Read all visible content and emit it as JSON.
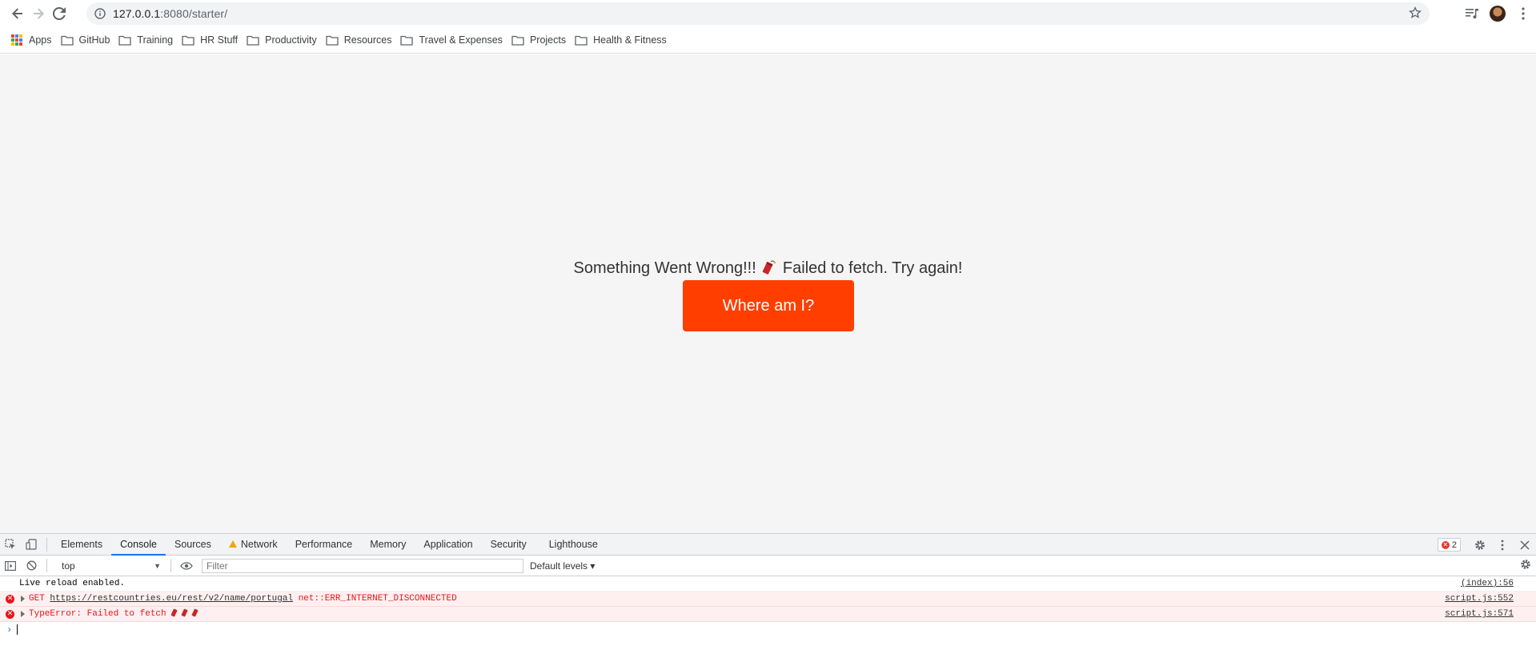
{
  "browser": {
    "url_host": "127.0.0.1",
    "url_rest": ":8080/starter/"
  },
  "bookmarks": [
    {
      "label": "Apps",
      "icon": "apps-grid-icon"
    },
    {
      "label": "GitHub",
      "icon": "folder-icon"
    },
    {
      "label": "Training",
      "icon": "folder-icon"
    },
    {
      "label": "HR Stuff",
      "icon": "folder-icon"
    },
    {
      "label": "Productivity",
      "icon": "folder-icon"
    },
    {
      "label": "Resources",
      "icon": "folder-icon"
    },
    {
      "label": "Travel & Expenses",
      "icon": "folder-icon"
    },
    {
      "label": "Projects",
      "icon": "folder-icon"
    },
    {
      "label": "Health & Fitness",
      "icon": "folder-icon"
    }
  ],
  "page": {
    "error_part1": "Something Went Wrong!!!",
    "error_part2": "Failed to fetch. Try again!",
    "button_label": "Where am I?",
    "button_color": "#ff3e00",
    "background": "#f5f5f5"
  },
  "devtools": {
    "tabs": [
      "Elements",
      "Console",
      "Sources",
      "Network",
      "Performance",
      "Memory",
      "Application",
      "Security",
      "Lighthouse"
    ],
    "active_tab": "Console",
    "warning_tab": "Network",
    "error_count": "2",
    "context": "top",
    "filter_placeholder": "Filter",
    "levels": "Default levels ▾",
    "logs": [
      {
        "type": "info",
        "text": "Live reload enabled.",
        "source": "(index):56"
      },
      {
        "type": "error",
        "method": "GET",
        "url": "https://restcountries.eu/rest/v2/name/portugal",
        "error": "net::ERR_INTERNET_DISCONNECTED",
        "source": "script.js:552"
      },
      {
        "type": "error",
        "text": "TypeError: Failed to fetch",
        "source": "script.js:571"
      }
    ]
  }
}
